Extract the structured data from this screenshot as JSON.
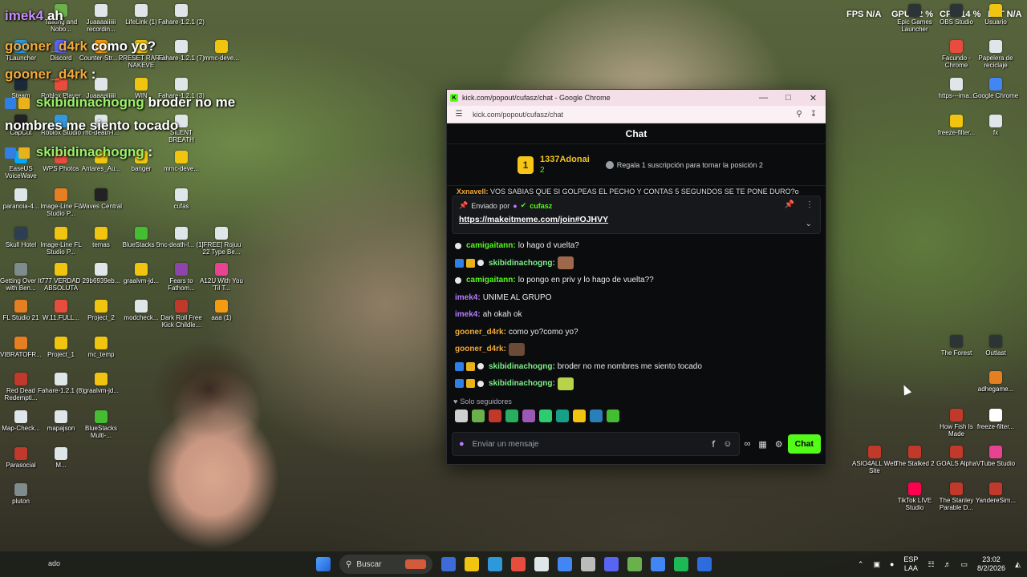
{
  "overlay": {
    "lines": [
      {
        "name": "imek4",
        "msg": "ah",
        "color": "purple"
      },
      {
        "name": "gooner_d4rk",
        "msg": "como yo?",
        "color": "orange"
      },
      {
        "name": "gooner_d4rk",
        "msg": ":",
        "color": "orange"
      },
      {
        "name": "skibidinachogng",
        "msg": "broder no me",
        "color": "green"
      },
      {
        "name": "",
        "msg": "nombres me siento tocado",
        "color": "white"
      },
      {
        "name": "skibidinachogng",
        "msg": ":",
        "color": "green"
      }
    ]
  },
  "hud": {
    "fps_label": "FPS",
    "fps_val": "N/A",
    "gpu_label": "GPU",
    "gpu_val": "12 %",
    "cpu_label": "CPU",
    "cpu_val": "14 %",
    "lat_label": "LAT",
    "lat_val": "N/A"
  },
  "desktop_icons_left": [
    [
      "Talking and Nobo...",
      "#6ab04c"
    ],
    [
      "Juaaaaiiiiii recordin...",
      "#dfe6e9"
    ],
    [
      "LifeLink (1)",
      "#dfe6e9"
    ],
    [
      "Fahare-1.2.1 (2)",
      "#dfe6e9"
    ],
    [
      "TLauncher",
      "#2d98da"
    ],
    [
      "Discord",
      "#5865f2"
    ],
    [
      "Counter-Str... 2",
      "#f39c12"
    ],
    [
      "PRESET RARE NAKEVE",
      "#f1c40f"
    ],
    [
      "Fahare-1.2.1 (7)",
      "#dfe6e9"
    ],
    [
      "mmc-deve...",
      "#f1c40f"
    ],
    [
      "Steam",
      "#1b2838"
    ],
    [
      "Roblox Player",
      "#e74c3c"
    ],
    [
      "Juaaaaiiiiii",
      "#dfe6e9"
    ],
    [
      "WIN",
      "#f1c40f"
    ],
    [
      "Fahare-1.2.1 (3)",
      "#dfe6e9"
    ],
    [
      "CapCut",
      "#222222"
    ],
    [
      "Roblox Studio",
      "#3498db"
    ],
    [
      "mc-death-l...",
      "#dfe6e9"
    ],
    [
      "SILENT BREATH",
      "#dfe6e9"
    ],
    [
      "EaseUS VoiceWave",
      "#00a8ff"
    ],
    [
      "WPS Photos",
      "#e74c3c"
    ],
    [
      "Antares_Au...",
      "#f1c40f"
    ],
    [
      "banger",
      "#f1c40f"
    ],
    [
      "mmc-deve...",
      "#f1c40f"
    ],
    [
      "paranoia-4...",
      "#dfe6e9"
    ],
    [
      "Image-Line FL Studio P...",
      "#e67e22"
    ],
    [
      "Waves Central",
      "#222222"
    ],
    [
      "cufas",
      "#dfe6e9"
    ],
    [
      "Skull Hotel",
      "#2c3e50"
    ],
    [
      "Image-Line FL Studio P...",
      "#f1c40f"
    ],
    [
      "temas",
      "#f1c40f"
    ],
    [
      "BlueStacks 5",
      "#44bd32"
    ],
    [
      "mc-death-l... (1)",
      "#dfe6e9"
    ],
    [
      "[FREE] Rojuu 22 Type Be...",
      "#dfe6e9"
    ],
    [
      "Getting Over It with Ben...",
      "#7f8c8d"
    ],
    [
      "777 VERDAD ABSOLUTA",
      "#f1c40f"
    ],
    [
      "29b6939eb...",
      "#dfe6e9"
    ],
    [
      "graalvm-jd...",
      "#f1c40f"
    ],
    [
      "Fears to Fathom...",
      "#8e44ad"
    ],
    [
      "A12U With You 'Til T...",
      "#e84393"
    ],
    [
      "FL Studio 21",
      "#e67e22"
    ],
    [
      "W.11.FULL...",
      "#e74c3c"
    ],
    [
      "Project_2",
      "#f1c40f"
    ],
    [
      "modcheck...",
      "#dfe6e9"
    ],
    [
      "Dark Roll Free Kick Childle...",
      "#c0392b"
    ],
    [
      "aaa (1)",
      "#f39c12"
    ],
    [
      "VIBRATOFR...",
      "#e67e22"
    ],
    [
      "Project_1",
      "#f1c40f"
    ],
    [
      "mc_temp",
      "#f1c40f"
    ],
    [
      "Red Dead Redempti...",
      "#c0392b"
    ],
    [
      "Fahare-1.2.1 (8)",
      "#dfe6e9"
    ],
    [
      "graalvm-jd...",
      "#f1c40f"
    ],
    [
      "Map-Check...",
      "#dfe6e9"
    ],
    [
      "mapajson",
      "#dfe6e9"
    ],
    [
      "BlueStacks Multi-...",
      "#44bd32"
    ],
    [
      "Parasocial",
      "#c0392b"
    ],
    [
      "M...",
      "#dfe6e9"
    ],
    [
      "pluton",
      "#7f8c8d"
    ]
  ],
  "desktop_icons_right": [
    [
      "Epic Games Launcher",
      "#2d3436"
    ],
    [
      "OBS Studio",
      "#2d3436"
    ],
    [
      "Usuario",
      "#f1c40f"
    ],
    [
      "Facundo - Chrome",
      "#e74c3c"
    ],
    [
      "Papelera de reciclaje",
      "#dfe6e9"
    ],
    [
      "https---ima...",
      "#dfe6e9"
    ],
    [
      "Google Chrome",
      "#4285f4"
    ],
    [
      "freeze-filter...",
      "#f1c40f"
    ],
    [
      "fx",
      "#dfe6e9"
    ],
    [
      "The Forest",
      "#2d3436"
    ],
    [
      "Outlast",
      "#2d3436"
    ],
    [
      "adhegame...",
      "#e67e22"
    ],
    [
      "How Fish Is Made",
      "#c0392b"
    ],
    [
      "freeze-filter...",
      "#ffffff"
    ],
    [
      "ASIO4ALL Web Site",
      "#c0392b"
    ],
    [
      "The Stalked 2",
      "#c0392b"
    ],
    [
      "GOALS Alpha",
      "#c0392b"
    ],
    [
      "VTube Studio",
      "#e84393"
    ],
    [
      "TikTok LIVE Studio",
      "#ff0050"
    ],
    [
      "The Stanley Parable D...",
      "#c0392b"
    ],
    [
      "YandereSim...",
      "#c0392b"
    ]
  ],
  "browser": {
    "title": "kick.com/popout/cufasz/chat - Google Chrome",
    "url": "kick.com/popout/cufasz/chat",
    "chat_title": "Chat",
    "leader": {
      "rank": "1",
      "name": "1337Adonai",
      "count": "2",
      "gift_text": "Regala 1 suscripción para tomar la posición 2"
    },
    "scroll_line": {
      "name": "Xxnavell:",
      "msg": "VOS SABIAS QUE SI GOLPEAS EL PECHO Y CONTAS 5 SEGUNDOS SE TE PONE DURO?o"
    },
    "pinned": {
      "label": "Enviado por",
      "user": "cufasz",
      "link": "https://makeitmeme.com/join#OJHVY"
    },
    "messages": [
      {
        "user": "camigaitann:",
        "text": "lo hago d vuelta?",
        "color": "green",
        "badges": "dot"
      },
      {
        "user": "skibidinachogng:",
        "text": "",
        "color": "mint",
        "badges": "full",
        "emote": "#a0684a"
      },
      {
        "user": "camigaitann:",
        "text": "lo pongo en priv y lo hago de vuelta??",
        "color": "green",
        "badges": "dot"
      },
      {
        "user": "imek4:",
        "text": "UNIME AL GRUPO",
        "color": "purple",
        "badges": "none"
      },
      {
        "user": "imek4:",
        "text": "ah okah ok",
        "color": "purple",
        "badges": "none"
      },
      {
        "user": "gooner_d4rk:",
        "text": "como yo?como yo?",
        "color": "orange",
        "badges": "none"
      },
      {
        "user": "gooner_d4rk:",
        "text": "",
        "color": "orange",
        "badges": "none",
        "emote": "#6b4a38"
      },
      {
        "user": "skibidinachogng:",
        "text": "broder no me nombres me siento tocado",
        "color": "mint",
        "badges": "full"
      },
      {
        "user": "skibidinachogng:",
        "text": "",
        "color": "mint",
        "badges": "full",
        "emote": "#b8d24a"
      }
    ],
    "followers_label": "Solo seguidores",
    "emotes": [
      "#cfcfcf",
      "#6ab04c",
      "#c0392b",
      "#27ae60",
      "#9b59b6",
      "#2ecc71",
      "#16a085",
      "#f1c40f",
      "#2980b9",
      "#44bd32"
    ],
    "composer_placeholder": "Enviar un mensaje",
    "send_label": "Chat"
  },
  "taskbar": {
    "search_label": "Buscar",
    "apps": [
      "#3d6bd8",
      "#f1c40f",
      "#2d98da",
      "#e74c3c",
      "#dfe6e9",
      "#4285f4",
      "#bbbbbb",
      "#5865f2",
      "#6ab04c",
      "#4285f4",
      "#1db954",
      "#2d6cdf"
    ],
    "lang_top": "ESP",
    "lang_bottom": "LAA",
    "time": "23:02",
    "date": "8/2/2026",
    "left_text": "ado"
  },
  "accent": "#53fc18"
}
